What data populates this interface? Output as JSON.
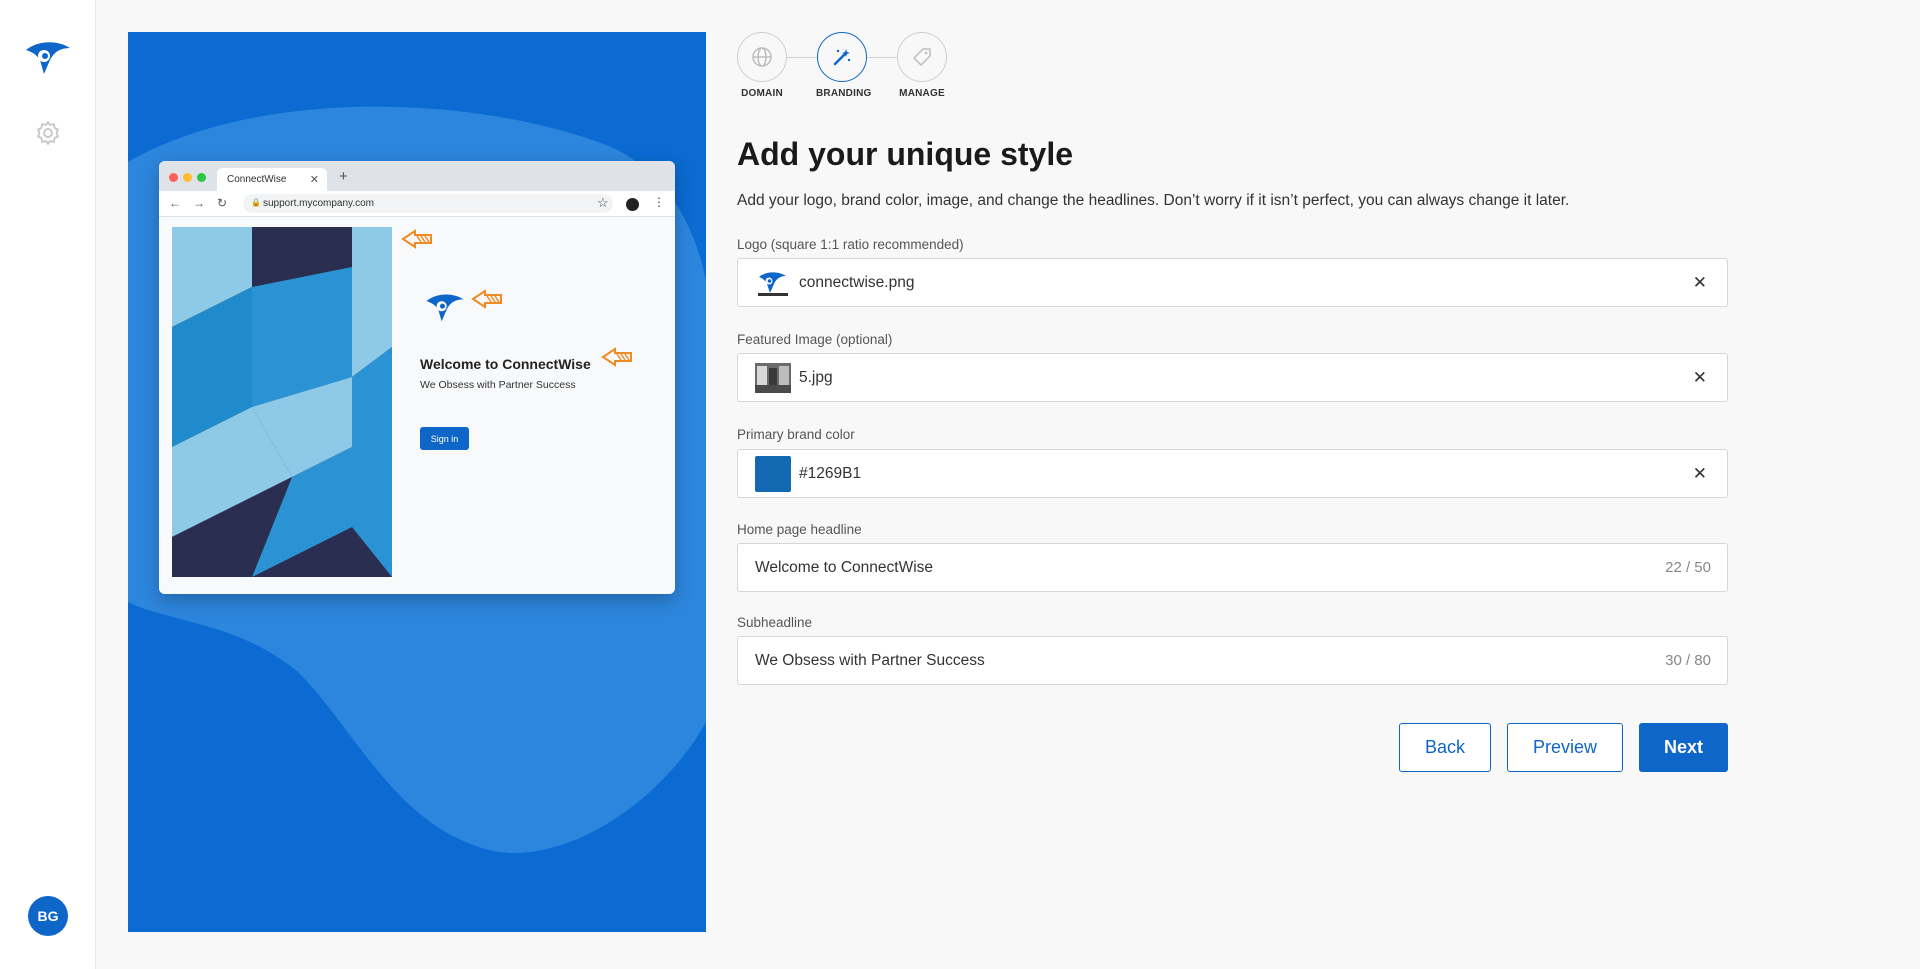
{
  "sidebar": {
    "logo_icon": "connectwise-logo-icon",
    "settings_icon": "gear-icon",
    "avatar_initials": "BG"
  },
  "preview": {
    "tab_title": "ConnectWise",
    "url": "support.mycompany.com",
    "headline": "Welcome to ConnectWise",
    "subheadline": "We Obsess with Partner Success",
    "signin_label": "Sign in"
  },
  "stepper": {
    "steps": [
      {
        "label": "DOMAIN",
        "icon": "globe-icon",
        "active": false
      },
      {
        "label": "BRANDING",
        "icon": "magic-wand-icon",
        "active": true
      },
      {
        "label": "MANAGE",
        "icon": "tag-icon",
        "active": false
      }
    ]
  },
  "form": {
    "title": "Add your unique style",
    "intro": "Add your logo, brand color, image, and change the headlines. Don’t worry if it isn’t perfect, you can always change it later.",
    "logo": {
      "label": "Logo (square 1:1 ratio recommended)",
      "value": "connectwise.png"
    },
    "featured_image": {
      "label": "Featured Image (optional)",
      "value": "5.jpg"
    },
    "brand_color": {
      "label": "Primary brand color",
      "value": "#1269B1"
    },
    "headline": {
      "label": "Home page headline",
      "value": "Welcome to ConnectWise",
      "count": "22 / 50"
    },
    "subheadline": {
      "label": "Subheadline",
      "value": "We Obsess with Partner Success",
      "count": "30 / 80"
    },
    "clear_icon": "close-icon"
  },
  "actions": {
    "back": "Back",
    "preview": "Preview",
    "next": "Next"
  },
  "colors": {
    "accent": "#0F66C9",
    "panel_bg": "#0B6BD2",
    "brand_swatch": "#1269B1",
    "annotation_arrow": "#F08A24"
  }
}
